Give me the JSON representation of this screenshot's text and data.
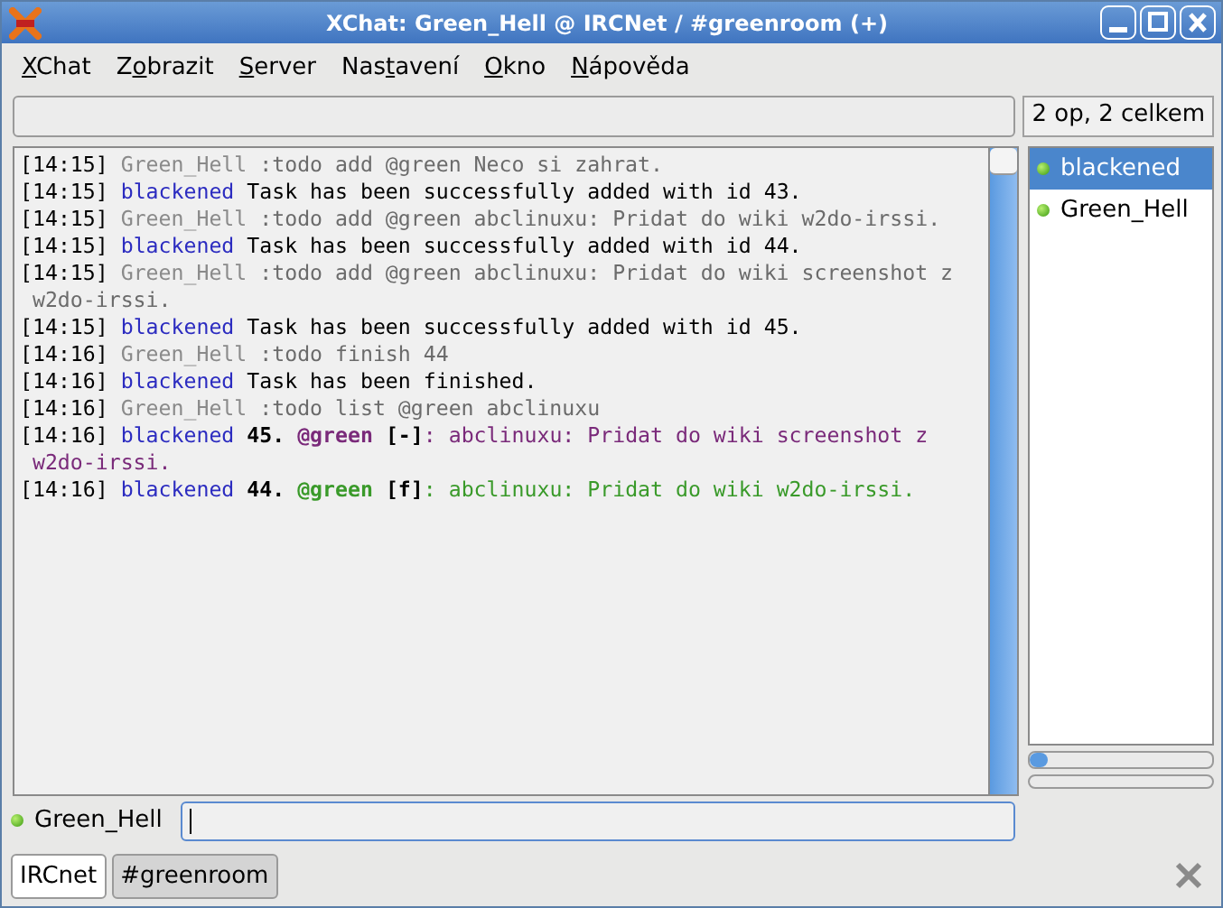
{
  "window": {
    "title": "XChat: Green_Hell @ IRCNet / #greenroom (+)"
  },
  "menu": [
    {
      "key": "X",
      "after": "Chat"
    },
    {
      "before": "Z",
      "key": "o",
      "after": "brazit"
    },
    {
      "key": "S",
      "after": "erver"
    },
    {
      "before": "Nas",
      "key": "t",
      "after": "avení"
    },
    {
      "key": "O",
      "after": "kno"
    },
    {
      "key": "N",
      "after": "ápověda"
    }
  ],
  "topic": {
    "user_count": "2 op, 2 celkem"
  },
  "messages": [
    {
      "time": "[14:15]",
      "nick": "Green_Hell",
      "kind": "own",
      "segments": [
        {
          "text": ":todo add @green Neco si zahrat."
        }
      ]
    },
    {
      "time": "[14:15]",
      "nick": "blackened",
      "kind": "other",
      "segments": [
        {
          "text": "Task has been successfully added with id 43."
        }
      ]
    },
    {
      "time": "[14:15]",
      "nick": "Green_Hell",
      "kind": "own",
      "segments": [
        {
          "text": ":todo add @green abclinuxu: Pridat do wiki w2do-irssi."
        }
      ]
    },
    {
      "time": "[14:15]",
      "nick": "blackened",
      "kind": "other",
      "segments": [
        {
          "text": "Task has been successfully added with id 44."
        }
      ]
    },
    {
      "time": "[14:15]",
      "nick": "Green_Hell",
      "kind": "own",
      "segments": [
        {
          "text": ":todo add @green abclinuxu: Pridat do wiki screenshot z w2do-irssi."
        }
      ]
    },
    {
      "time": "[14:15]",
      "nick": "blackened",
      "kind": "other",
      "segments": [
        {
          "text": "Task has been successfully added with id 45."
        }
      ]
    },
    {
      "time": "[14:16]",
      "nick": "Green_Hell",
      "kind": "own",
      "segments": [
        {
          "text": ":todo finish 44"
        }
      ]
    },
    {
      "time": "[14:16]",
      "nick": "blackened",
      "kind": "other",
      "segments": [
        {
          "text": "Task has been finished."
        }
      ]
    },
    {
      "time": "[14:16]",
      "nick": "Green_Hell",
      "kind": "own",
      "segments": [
        {
          "text": ":todo list @green abclinuxu"
        }
      ]
    },
    {
      "time": "[14:16]",
      "nick": "blackened",
      "kind": "other",
      "segments": [
        {
          "text": "45. ",
          "bold": true
        },
        {
          "text": "@green",
          "bold": true,
          "color": "#7a2a7a"
        },
        {
          "text": " [-]",
          "bold": true
        },
        {
          "text": ": abclinuxu: Pridat do wiki screenshot z w2do-irssi.",
          "color": "#7a2a7a"
        }
      ]
    },
    {
      "time": "[14:16]",
      "nick": "blackened",
      "kind": "other",
      "segments": [
        {
          "text": "44. ",
          "bold": true
        },
        {
          "text": "@green",
          "bold": true,
          "color": "#3a9a2a"
        },
        {
          "text": " [f]",
          "bold": true
        },
        {
          "text": ": abclinuxu: Pridat do wiki w2do-irssi.",
          "color": "#3a9a2a"
        }
      ]
    }
  ],
  "users": [
    {
      "name": "blackened",
      "selected": true
    },
    {
      "name": "Green_Hell",
      "selected": false
    }
  ],
  "input": {
    "nick": "Green_Hell"
  },
  "tabs": [
    {
      "label": "IRCnet",
      "selected": true
    },
    {
      "label": "#greenroom",
      "selected": false
    }
  ]
}
